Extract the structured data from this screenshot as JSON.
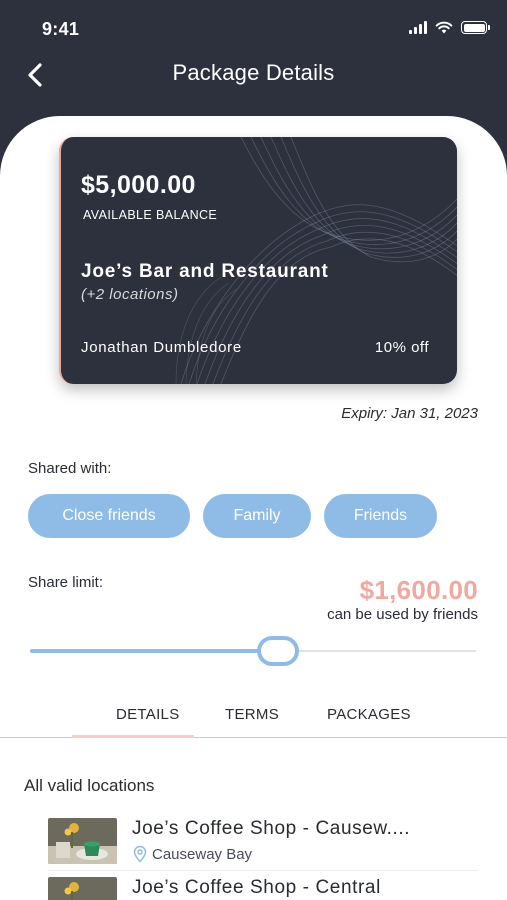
{
  "status_bar": {
    "time": "9:41",
    "icons": [
      "signal-icon",
      "wifi-icon",
      "battery-icon"
    ]
  },
  "nav": {
    "title": "Package Details",
    "back_icon": "chevron-left-icon"
  },
  "card": {
    "balance": "$5,000.00",
    "balance_label": "AVAILABLE BALANCE",
    "merchant": "Joe’s Bar and Restaurant",
    "locations": "(+2 locations)",
    "holder": "Jonathan Dumbledore",
    "discount": "10% off"
  },
  "expiry": "Expiry: Jan 31, 2023",
  "shared": {
    "label": "Shared with:",
    "chips": [
      "Close friends",
      "Family",
      "Friends"
    ]
  },
  "share_limit": {
    "label": "Share limit:",
    "amount": "$1,600.00",
    "sub": "can be used by friends",
    "slider_fraction": 0.556
  },
  "tabs": {
    "items": [
      "DETAILS",
      "TERMS",
      "PACKAGES"
    ],
    "active": "DETAILS"
  },
  "locations": {
    "title": "All valid locations",
    "items": [
      {
        "name": "Joe’s Coffee Shop - Causew....",
        "area": "Causeway Bay"
      },
      {
        "name": "Joe’s Coffee Shop - Central",
        "area": ""
      }
    ]
  },
  "colors": {
    "dark": "#2d303d",
    "accent_blue": "#8fbce6",
    "accent_pink": "#f1a8a0"
  }
}
